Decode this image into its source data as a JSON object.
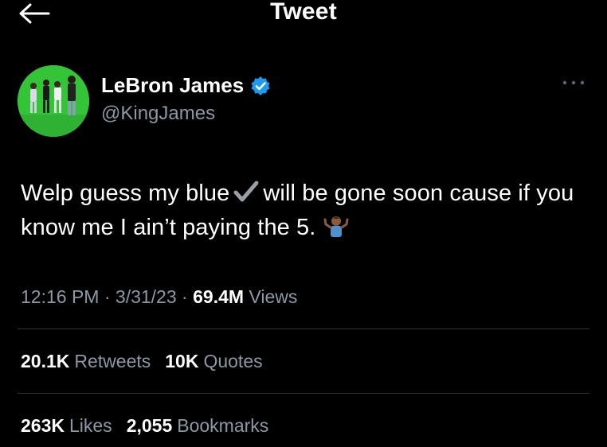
{
  "header": {
    "title": "Tweet",
    "back_icon": "arrow-left-icon"
  },
  "author": {
    "name": "LeBron James",
    "handle": "@KingJames",
    "verified": true,
    "badge_color": "#1d9bf0",
    "more_icon": "more-horizontal-icon"
  },
  "tweet": {
    "text_part1": "Welp guess my blue",
    "emoji_check": "heavy-check-mark-emoji",
    "text_part2": "will be gone soon cause if you know me I ain’t paying the 5.",
    "emoji_shrug": "man-shrugging-emoji"
  },
  "meta": {
    "time": "12:16 PM",
    "sep1": "·",
    "date": "3/31/23",
    "sep2": "·",
    "views_count": "69.4M",
    "views_label": "Views"
  },
  "stats_row1": [
    {
      "count": "20.1K",
      "label": "Retweets"
    },
    {
      "count": "10K",
      "label": "Quotes"
    }
  ],
  "stats_row2": [
    {
      "count": "263K",
      "label": "Likes"
    },
    {
      "count": "2,055",
      "label": "Bookmarks"
    }
  ],
  "colors": {
    "background": "#000000",
    "text_primary": "#ffffff",
    "text_secondary": "#8b98a5",
    "divider": "#2f3336",
    "avatar_bg": "#34c437"
  }
}
